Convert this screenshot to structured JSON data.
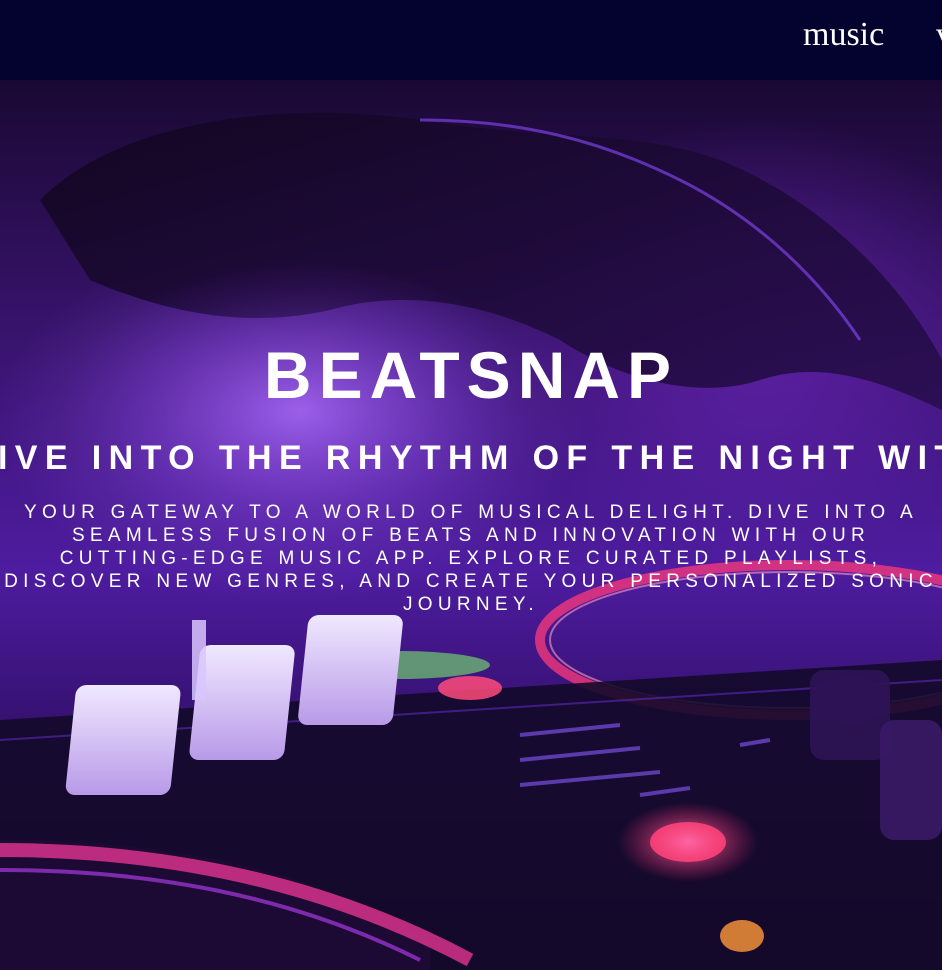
{
  "nav": {
    "items": [
      {
        "label": "music"
      },
      {
        "label": "v"
      }
    ]
  },
  "hero": {
    "title": "BEATSNAP",
    "subtitle": "DIVE INTO THE RHYTHM OF THE NIGHT WITH",
    "description": "YOUR GATEWAY TO A WORLD OF MUSICAL DELIGHT. DIVE INTO A SEAMLESS FUSION OF BEATS AND INNOVATION WITH OUR CUTTING-EDGE MUSIC APP. EXPLORE CURATED PLAYLISTS, DISCOVER NEW GENRES, AND CREATE YOUR PERSONALIZED SONIC JOURNEY.",
    "background_image": "dj-mixer-hands-purple-neon-photo"
  },
  "colors": {
    "navbar_bg": "#04022e",
    "text": "#ffffff",
    "accent_purple": "#6a2fd6",
    "accent_pink": "#ff3a8c"
  }
}
